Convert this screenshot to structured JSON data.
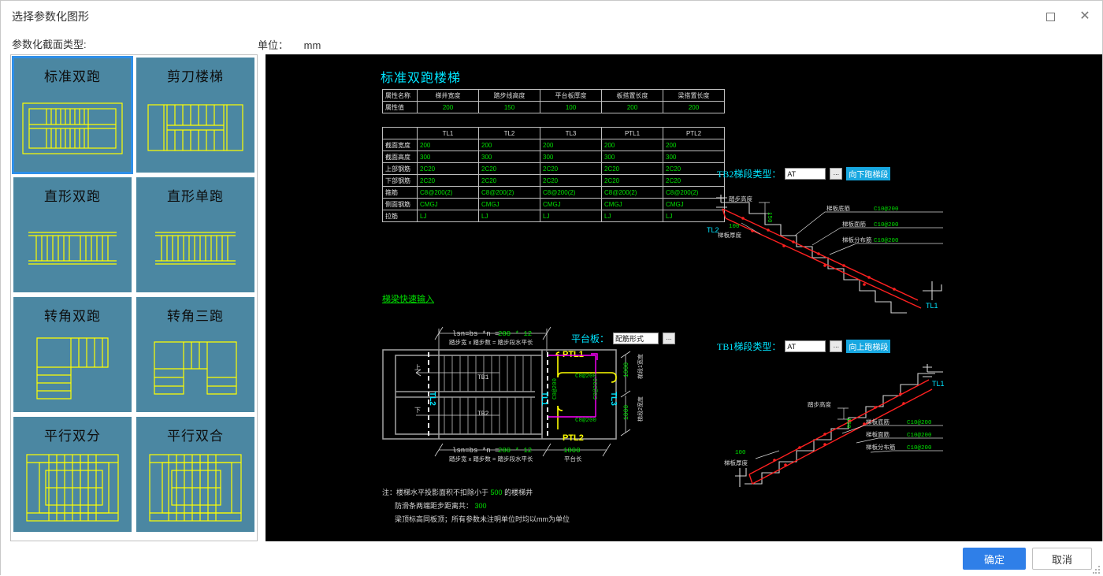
{
  "window": {
    "title": "选择参数化图形",
    "maximize_icon": "maximize-icon",
    "close_icon": "close-icon"
  },
  "subheader": {
    "type_label": "参数化截面类型:",
    "unit_label": "单位：",
    "unit_value": "mm"
  },
  "tiles": [
    {
      "label": "标准双跑",
      "art": "standard-double-run",
      "selected": true
    },
    {
      "label": "剪刀楼梯",
      "art": "scissor-stair",
      "selected": false
    },
    {
      "label": "直形双跑",
      "art": "straight-double-run",
      "selected": false
    },
    {
      "label": "直形单跑",
      "art": "straight-single-run",
      "selected": false
    },
    {
      "label": "转角双跑",
      "art": "corner-double-run",
      "selected": false
    },
    {
      "label": "转角三跑",
      "art": "corner-triple-run",
      "selected": false
    },
    {
      "label": "平行双分",
      "art": "parallel-split",
      "selected": false
    },
    {
      "label": "平行双合",
      "art": "parallel-merge",
      "selected": false
    }
  ],
  "drawing": {
    "title": "标准双跑楼梯",
    "attr_table": {
      "row_headers": [
        "属性名称",
        "属性值"
      ],
      "columns": [
        "梯井宽度",
        "踏步线高度",
        "平台板厚度",
        "板搭置长度",
        "梁搭置长度"
      ],
      "values": [
        "200",
        "150",
        "100",
        "200",
        "200"
      ]
    },
    "beam_table": {
      "columns": [
        "TL1",
        "TL2",
        "TL3",
        "PTL1",
        "PTL2"
      ],
      "rows": [
        {
          "label": "截面宽度",
          "values": [
            "200",
            "200",
            "200",
            "200",
            "200"
          ]
        },
        {
          "label": "截面高度",
          "values": [
            "300",
            "300",
            "300",
            "300",
            "300"
          ]
        },
        {
          "label": "上部钢筋",
          "values": [
            "2C20",
            "2C20",
            "2C20",
            "2C20",
            "2C20"
          ]
        },
        {
          "label": "下部钢筋",
          "values": [
            "2C20",
            "2C20",
            "2C20",
            "2C20",
            "2C20"
          ]
        },
        {
          "label": "箍筋",
          "values": [
            "C8@200(2)",
            "C8@200(2)",
            "C8@200(2)",
            "C8@200(2)",
            "C8@200(2)"
          ]
        },
        {
          "label": "侧面钢筋",
          "values": [
            "CMGJ",
            "CMGJ",
            "CMGJ",
            "CMGJ",
            "CMGJ"
          ]
        },
        {
          "label": "拉筋",
          "values": [
            "LJ",
            "LJ",
            "LJ",
            "LJ",
            "LJ"
          ]
        }
      ]
    },
    "quick_input_link": "梯梁快速输入",
    "plan": {
      "dim_top": "lsn=bs *n = 280 * 12",
      "dim_top_note": "踏步宽 x 踏步数 = 踏步段水平长",
      "dim_bottom": "lsn=bs *n = 280 * 12",
      "dim_bottom_note": "踏步宽 x 踏步数 = 踏步段水平长",
      "platform_len_value": "1800",
      "platform_len_note": "平台长",
      "dim_right_top": "1000",
      "dim_right_bottom": "1000",
      "dim_right_top_note": "梯段1宽度",
      "dim_right_bottom_note": "梯段2宽度",
      "labels": {
        "run_up": "上",
        "run_down": "下",
        "tb1": "TB1",
        "tb2": "TB2",
        "tl1": "TL1",
        "tl2": "TL2",
        "tl3": "TL3",
        "ptl1": "PTL1",
        "ptl2": "PTL2",
        "rebar_h1": "C8@200",
        "rebar_h2": "C8@200",
        "rebar_v1": "C8@200",
        "rebar_v2": "C8@200"
      },
      "platform_slab": {
        "label": "平台板：",
        "value": "配筋形式",
        "ellipsis": "..."
      }
    },
    "sections": [
      {
        "heading": "TB2梯段类型：",
        "type_value": "AT",
        "ellipsis": "...",
        "tag": "向下跑梯段",
        "step_height_label": "踏步高度",
        "step_height_value": "150",
        "slab_thick_label": "梯板厚度",
        "slab_thick_value": "100",
        "callouts": [
          {
            "label": "梯板底筋",
            "value": "C10@200"
          },
          {
            "label": "梯板面筋",
            "value": "C10@200"
          },
          {
            "label": "梯板分布筋",
            "value": "C10@200"
          }
        ],
        "beam_left": "TL2",
        "beam_right": "TL1"
      },
      {
        "heading": "TB1梯段类型：",
        "type_value": "AT",
        "ellipsis": "...",
        "tag": "向上跑梯段",
        "step_height_label": "踏步高度",
        "step_height_value": "150",
        "slab_thick_label": "梯板厚度",
        "slab_thick_value": "100",
        "callouts": [
          {
            "label": "梯板底筋",
            "value": "C10@200"
          },
          {
            "label": "梯板面筋",
            "value": "C10@200"
          },
          {
            "label": "梯板分布筋",
            "value": "C10@200"
          }
        ],
        "beam_left": "TL2",
        "beam_right": "TL1"
      }
    ],
    "notes": {
      "line1_prefix": "注：楼梯水平投影面积不扣除小于",
      "line1_value": "500",
      "line1_suffix": "的楼梯井",
      "line2_prefix": "防滑条两端距步距离共：",
      "line2_value": "300",
      "line3": "梁顶标高同板顶；所有参数未注明单位时均以mm为单位"
    }
  },
  "footer": {
    "ok_label": "确定",
    "cancel_label": "取消"
  },
  "colors": {
    "accent": "#2f7fe8",
    "tile_bg": "#4b87a2",
    "cad_yellow": "#ffff00",
    "cad_cyan": "#00e5ff",
    "cad_green": "#00e000",
    "cad_red": "#ff2020",
    "cad_magenta": "#ff00ff",
    "cad_white": "#d6d6d6"
  }
}
